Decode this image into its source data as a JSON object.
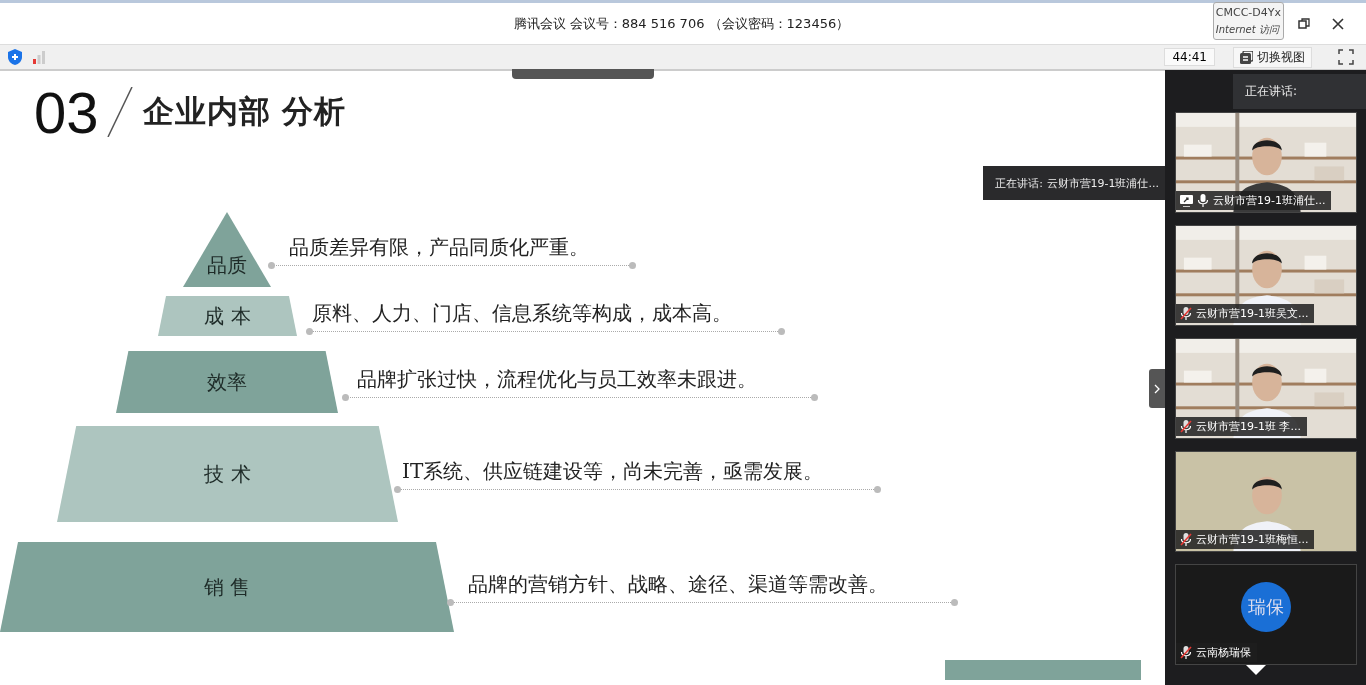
{
  "window": {
    "title": "腾讯会议 会议号：884 516 706 （会议密码：123456）",
    "network_tooltip": [
      "CMCC-D4Yx",
      "Internet 访问"
    ]
  },
  "toolbar": {
    "timer": "44:41",
    "switch_view": "切换视图"
  },
  "slide": {
    "number": "03",
    "title": "企业内部 分析",
    "tiers": [
      {
        "label": "品质",
        "text": "品质差异有限，产品同质化严重。",
        "color": "#7fa39a"
      },
      {
        "label": "成 本",
        "text": "原料、人力、门店、信息系统等构成，成本高。",
        "color": "#adc5bf"
      },
      {
        "label": "效率",
        "text": "品牌扩张过快，流程优化与员工效率未跟进。",
        "color": "#7fa39a"
      },
      {
        "label": "技 术",
        "text": "IT系统、供应链建设等，尚未完善，亟需发展。",
        "color": "#adc5bf"
      },
      {
        "label": "销 售",
        "text": "品牌的营销方针、战略、途径、渠道等需改善。",
        "color": "#7fa39a"
      }
    ]
  },
  "speaking_tooltip": "正在讲话: 云财市营19-1班浦仕...",
  "panel": {
    "header": "正在讲话:",
    "participants": [
      {
        "kind": "video",
        "name": "云财市营19-1班浦仕...",
        "muted": false,
        "sharing": true
      },
      {
        "kind": "video",
        "name": "云财市营19-1班吴文...",
        "muted": true,
        "sharing": false
      },
      {
        "kind": "video",
        "name": "云财市营19-1班 李...",
        "muted": true,
        "sharing": false
      },
      {
        "kind": "video",
        "name": "云财市营19-1班梅恒...",
        "muted": true,
        "sharing": false
      },
      {
        "kind": "avatar",
        "name": "云南杨瑞保",
        "muted": true,
        "sharing": false,
        "avatar_text": "瑞保"
      }
    ]
  }
}
